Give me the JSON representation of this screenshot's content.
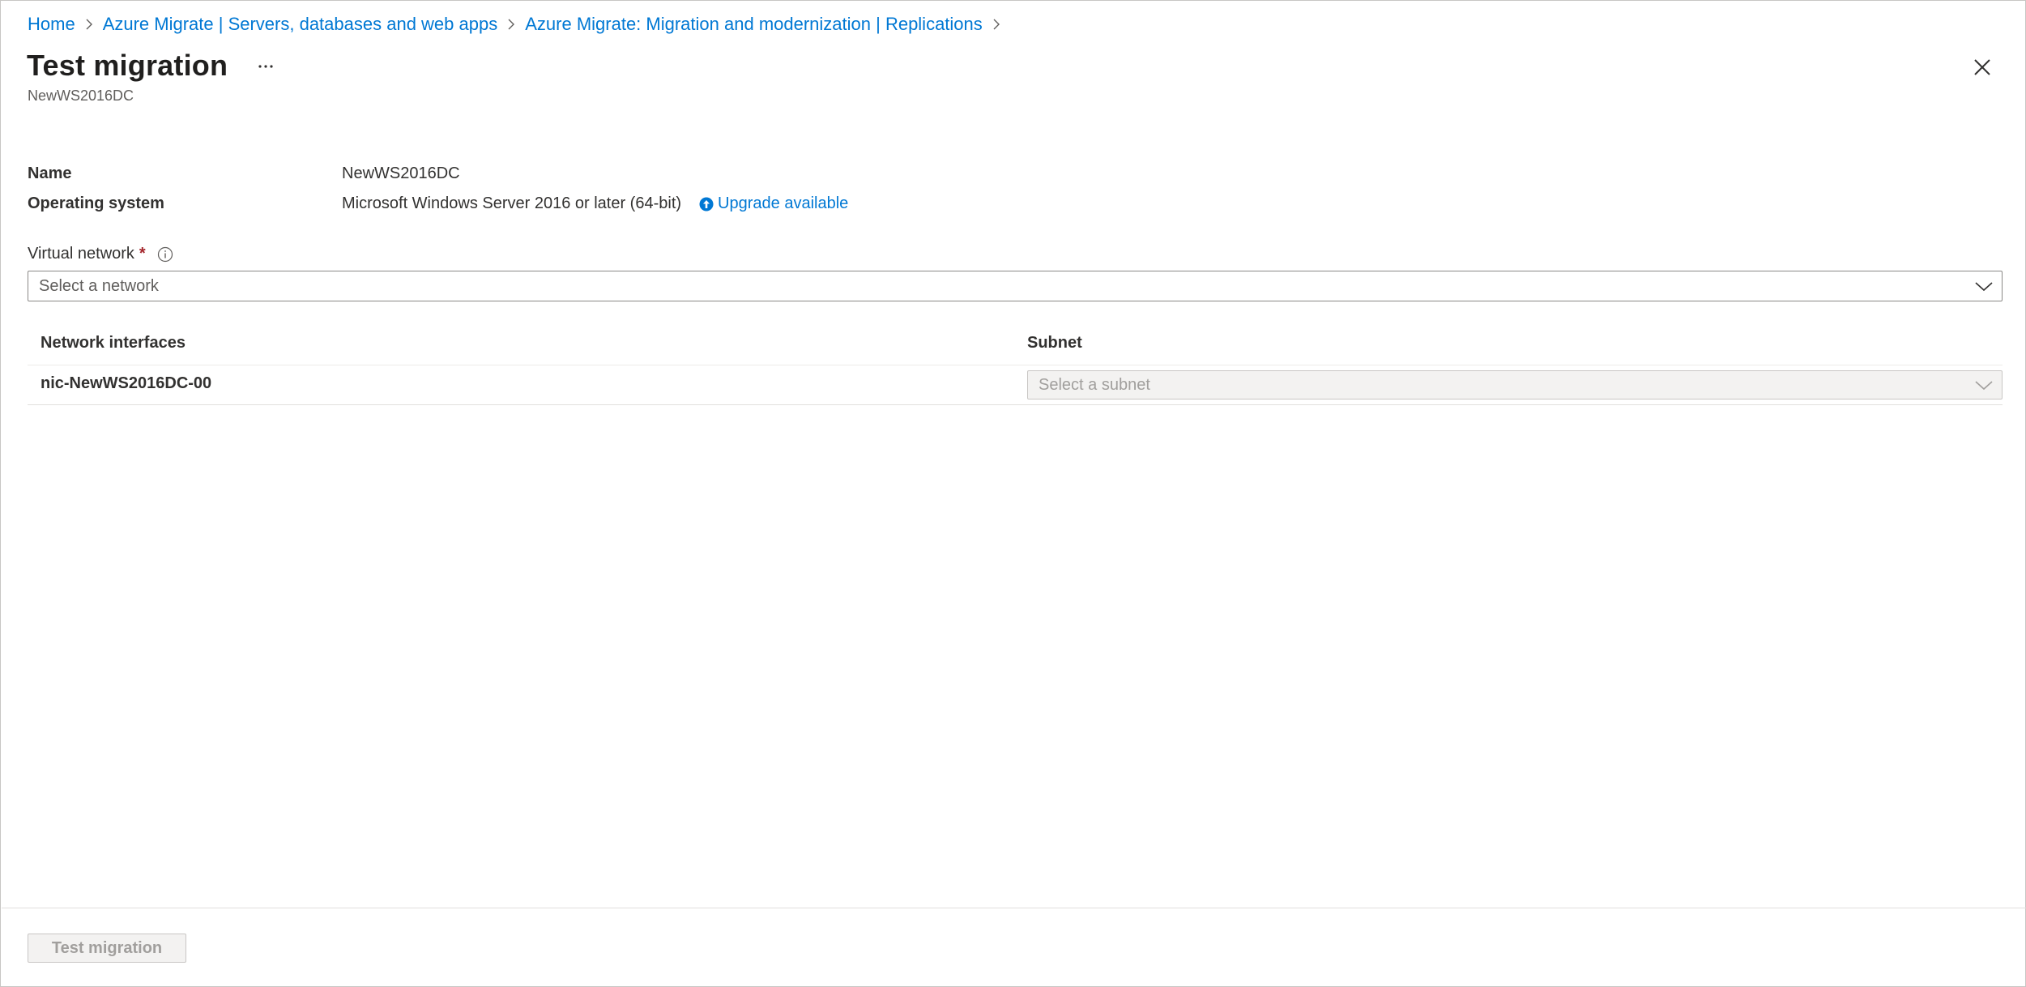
{
  "breadcrumb": {
    "items": [
      {
        "label": "Home"
      },
      {
        "label": "Azure Migrate | Servers, databases and web apps"
      },
      {
        "label": "Azure Migrate: Migration and modernization | Replications"
      }
    ]
  },
  "header": {
    "title": "Test migration",
    "more_label": "···",
    "subtitle": "NewWS2016DC"
  },
  "properties": {
    "name_label": "Name",
    "name_value": "NewWS2016DC",
    "os_label": "Operating system",
    "os_value": "Microsoft Windows Server 2016 or later (64-bit)",
    "upgrade_link": "Upgrade available"
  },
  "virtual_network": {
    "label": "Virtual network",
    "required_mark": "*",
    "placeholder": "Select a network"
  },
  "table": {
    "columns": [
      "Network interfaces",
      "Subnet"
    ],
    "rows": [
      {
        "interface": "nic-NewWS2016DC-00",
        "subnet_placeholder": "Select a subnet"
      }
    ]
  },
  "footer": {
    "primary_button": "Test migration"
  },
  "colors": {
    "link": "#0078d4",
    "required": "#a4262c",
    "disabled_bg": "#f3f2f1",
    "disabled_text": "#a19f9d"
  },
  "icons": {
    "breadcrumb_separator": "chevron-right-icon",
    "more": "more-icon",
    "close": "close-icon",
    "upgrade": "upgrade-arrow-icon",
    "info": "info-icon",
    "dropdown": "chevron-down-icon"
  }
}
